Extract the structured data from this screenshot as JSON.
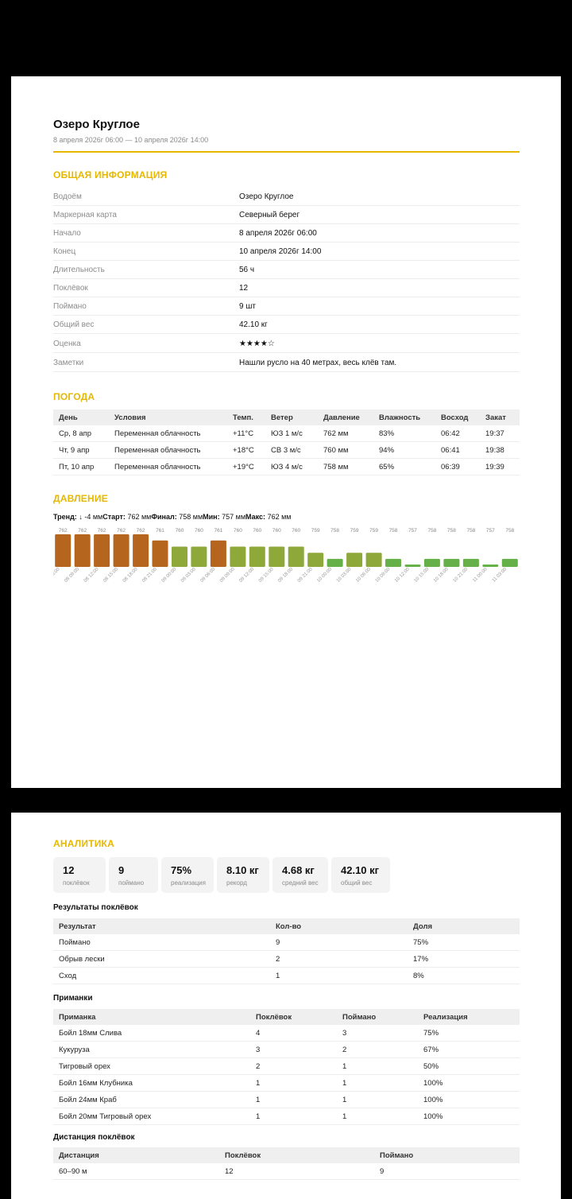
{
  "report": {
    "title": "Озеро Круглое",
    "subtitle": "8 апреля 2026г 06:00 — 10 апреля 2026г 14:00"
  },
  "general": {
    "heading": "ОБЩАЯ ИНФОРМАЦИЯ",
    "rows": [
      {
        "label": "Водоём",
        "value": "Озеро Круглое"
      },
      {
        "label": "Маркерная карта",
        "value": "Северный берег"
      },
      {
        "label": "Начало",
        "value": "8 апреля 2026г 06:00"
      },
      {
        "label": "Конец",
        "value": "10 апреля 2026г 14:00"
      },
      {
        "label": "Длительность",
        "value": "56 ч"
      },
      {
        "label": "Поклёвок",
        "value": "12"
      },
      {
        "label": "Поймано",
        "value": "9 шт"
      },
      {
        "label": "Общий вес",
        "value": "42.10 кг"
      },
      {
        "label": "Оценка",
        "value": "★★★★☆"
      },
      {
        "label": "Заметки",
        "value": "Нашли русло на 40 метрах, весь клёв там."
      }
    ]
  },
  "weather": {
    "heading": "ПОГОДА",
    "columns": [
      "День",
      "Условия",
      "Темп.",
      "Ветер",
      "Давление",
      "Влажность",
      "Восход",
      "Закат"
    ],
    "rows": [
      [
        "Ср, 8 апр",
        "Переменная облачность",
        "+11°C",
        "ЮЗ 1 м/с",
        "762 мм",
        "83%",
        "06:42",
        "19:37"
      ],
      [
        "Чт, 9 апр",
        "Переменная облачность",
        "+18°C",
        "СВ 3 м/с",
        "760 мм",
        "94%",
        "06:41",
        "19:38"
      ],
      [
        "Пт, 10 апр",
        "Переменная облачность",
        "+19°C",
        "ЮЗ 4 м/с",
        "758 мм",
        "65%",
        "06:39",
        "19:39"
      ]
    ]
  },
  "pressure": {
    "heading": "ДАВЛЕНИЕ",
    "trend_label": "Тренд:",
    "trend_value": "↓ -4 мм",
    "start_label": "Старт:",
    "start_value": "762 мм",
    "final_label": "Финал:",
    "final_value": "758 мм",
    "min_label": "Мин:",
    "min_value": "757 мм",
    "max_label": "Макс:",
    "max_value": "762 мм"
  },
  "chart_data": {
    "type": "bar",
    "categories": [
      "08 06:00",
      "08 09:00",
      "08 12:00",
      "08 15:00",
      "08 18:00",
      "08 21:00",
      "09 00:00",
      "09 03:00",
      "09 06:00",
      "09 09:00",
      "09 12:00",
      "09 15:00",
      "09 18:00",
      "09 21:00",
      "10 00:00",
      "10 03:00",
      "10 06:00",
      "10 09:00",
      "10 12:00",
      "10 15:00",
      "10 18:00",
      "10 21:00",
      "11 00:00",
      "11 03:00"
    ],
    "category_display": [
      "08 06:00",
      "08 09:00",
      "08 12:00",
      "08 15:00",
      "08 18:00",
      "08 21:00",
      "09 00:00",
      "09 03:00",
      "09 06:00",
      "09 09:00",
      "09 12:00",
      "09 15:00",
      "09 18:00",
      "09 21:00",
      "10 00:00",
      "10 03:00",
      "10 06:00",
      "10 09:00",
      "10 12:00",
      "10 15:00",
      "10 18:00",
      "10 21:00",
      "11 00:00",
      "11 03:00"
    ],
    "values": [
      762,
      762,
      762,
      762,
      762,
      761,
      760,
      760,
      761,
      760,
      760,
      760,
      760,
      759,
      758,
      759,
      759,
      758,
      757,
      758,
      758,
      758,
      757,
      758
    ],
    "ylim": [
      756.7,
      762
    ],
    "colors": {
      "high": "#b5651d",
      "mid": "#8ea83a",
      "low": "#66b04a"
    }
  },
  "analytics": {
    "heading": "АНАЛИТИКА",
    "stats": [
      {
        "value": "12",
        "label": "поклёвок"
      },
      {
        "value": "9",
        "label": "поймано"
      },
      {
        "value": "75%",
        "label": "реализация"
      },
      {
        "value": "8.10 кг",
        "label": "рекорд"
      },
      {
        "value": "4.68 кг",
        "label": "средний вес"
      },
      {
        "value": "42.10 кг",
        "label": "общий вес"
      }
    ],
    "results": {
      "heading": "Результаты поклёвок",
      "columns": [
        "Результат",
        "Кол-во",
        "Доля"
      ],
      "rows": [
        [
          "Поймано",
          "9",
          "75%"
        ],
        [
          "Обрыв лески",
          "2",
          "17%"
        ],
        [
          "Сход",
          "1",
          "8%"
        ]
      ]
    },
    "baits": {
      "heading": "Приманки",
      "columns": [
        "Приманка",
        "Поклёвок",
        "Поймано",
        "Реализация"
      ],
      "rows": [
        [
          "Бойл 18мм Слива",
          "4",
          "3",
          "75%"
        ],
        [
          "Кукуруза",
          "3",
          "2",
          "67%"
        ],
        [
          "Тигровый орех",
          "2",
          "1",
          "50%"
        ],
        [
          "Бойл 16мм Клубника",
          "1",
          "1",
          "100%"
        ],
        [
          "Бойл 24мм Краб",
          "1",
          "1",
          "100%"
        ],
        [
          "Бойл 20мм Тигровый орех",
          "1",
          "1",
          "100%"
        ]
      ]
    },
    "distance": {
      "heading": "Дистанция поклёвок",
      "columns": [
        "Дистанция",
        "Поклёвок",
        "Поймано"
      ],
      "rows": [
        [
          "60–90 м",
          "12",
          "9"
        ]
      ]
    }
  }
}
